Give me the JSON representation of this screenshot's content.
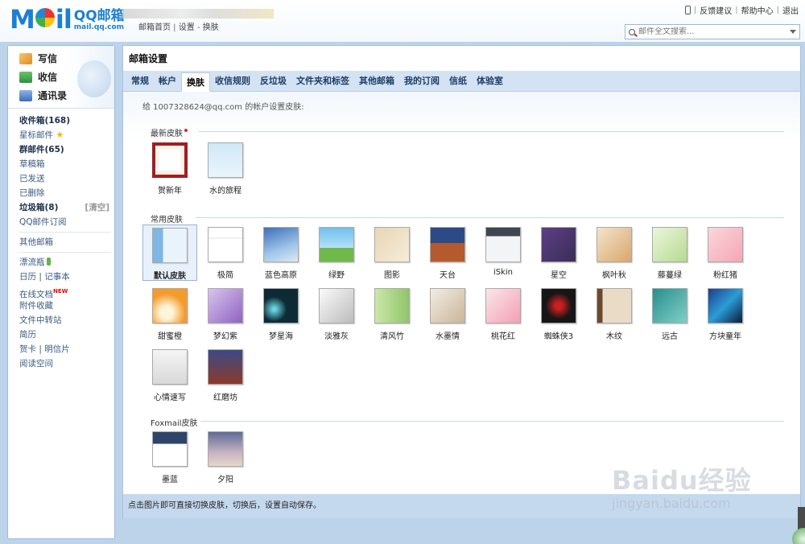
{
  "header": {
    "logo_mark_pre": "M",
    "logo_mark_post": "il",
    "logo_title": "QQ邮箱",
    "logo_url": "mail.qq.com",
    "links": [
      "邮箱首页",
      "设置",
      "换肤"
    ],
    "top_right": [
      "反馈建议",
      "帮助中心",
      "退出"
    ],
    "search_placeholder": "邮件全文搜索..."
  },
  "sidebar": {
    "quick": [
      "写信",
      "收信",
      "通讯录"
    ],
    "folders_a": [
      {
        "label": "收件箱(168)",
        "bold": true
      },
      {
        "label": "星标邮件",
        "bold": false,
        "icon": "star-icon"
      },
      {
        "label": "群邮件(65)",
        "bold": true
      },
      {
        "label": "草稿箱",
        "bold": false
      },
      {
        "label": "已发送",
        "bold": false
      },
      {
        "label": "已删除",
        "bold": false
      },
      {
        "label": "垃圾箱(8)",
        "bold": true,
        "action": "[清空]"
      },
      {
        "label": "QQ邮件订阅",
        "bold": false
      }
    ],
    "other_mail": "其他邮箱",
    "apps": [
      "漂流瓶",
      "日历",
      "记事本",
      "在线文档",
      "附件收藏",
      "文件中转站",
      "简历",
      "贺卡",
      "明信片",
      "阅读空间"
    ],
    "new_badge": "NEW"
  },
  "main": {
    "title": "邮箱设置",
    "tabs": [
      "常规",
      "帐户",
      "换肤",
      "收信规则",
      "反垃圾",
      "文件夹和标签",
      "其他邮箱",
      "我的订阅",
      "信纸",
      "体验室"
    ],
    "active_tab": "换肤",
    "desc": "给 1007328624@qq.com 的帐户设置皮肤:",
    "sections": {
      "latest": "最新皮肤",
      "common": "常用皮肤",
      "foxmail": "Foxmail皮肤"
    },
    "latest_skins": [
      "贺新年",
      "水的旅程"
    ],
    "common_skins": [
      "默认皮肤",
      "极简",
      "蓝色高原",
      "绿野",
      "图影",
      "天台",
      "iSkin",
      "星空",
      "枫叶秋",
      "藤蔓绿",
      "粉红猪",
      "甜蜜橙",
      "梦幻紫",
      "梦星海",
      "淡雅灰",
      "清风竹",
      "水墨情",
      "桃花红",
      "蜘蛛侠3",
      "木纹",
      "远古",
      "方块童年",
      "心情速写",
      "红磨坊"
    ],
    "foxmail_skins": [
      "墨蓝",
      "夕阳"
    ],
    "selected_skin": "默认皮肤",
    "footer": "点击图片即可直接切换皮肤，切换后，设置自动保存。"
  },
  "watermark": {
    "logo": "Baidu经验",
    "url": "jingyan.baidu.com"
  },
  "colors": {
    "brand": "#1d7fd1",
    "frame": "#bcd3ea",
    "tab_bar": "#d4e3f4"
  }
}
